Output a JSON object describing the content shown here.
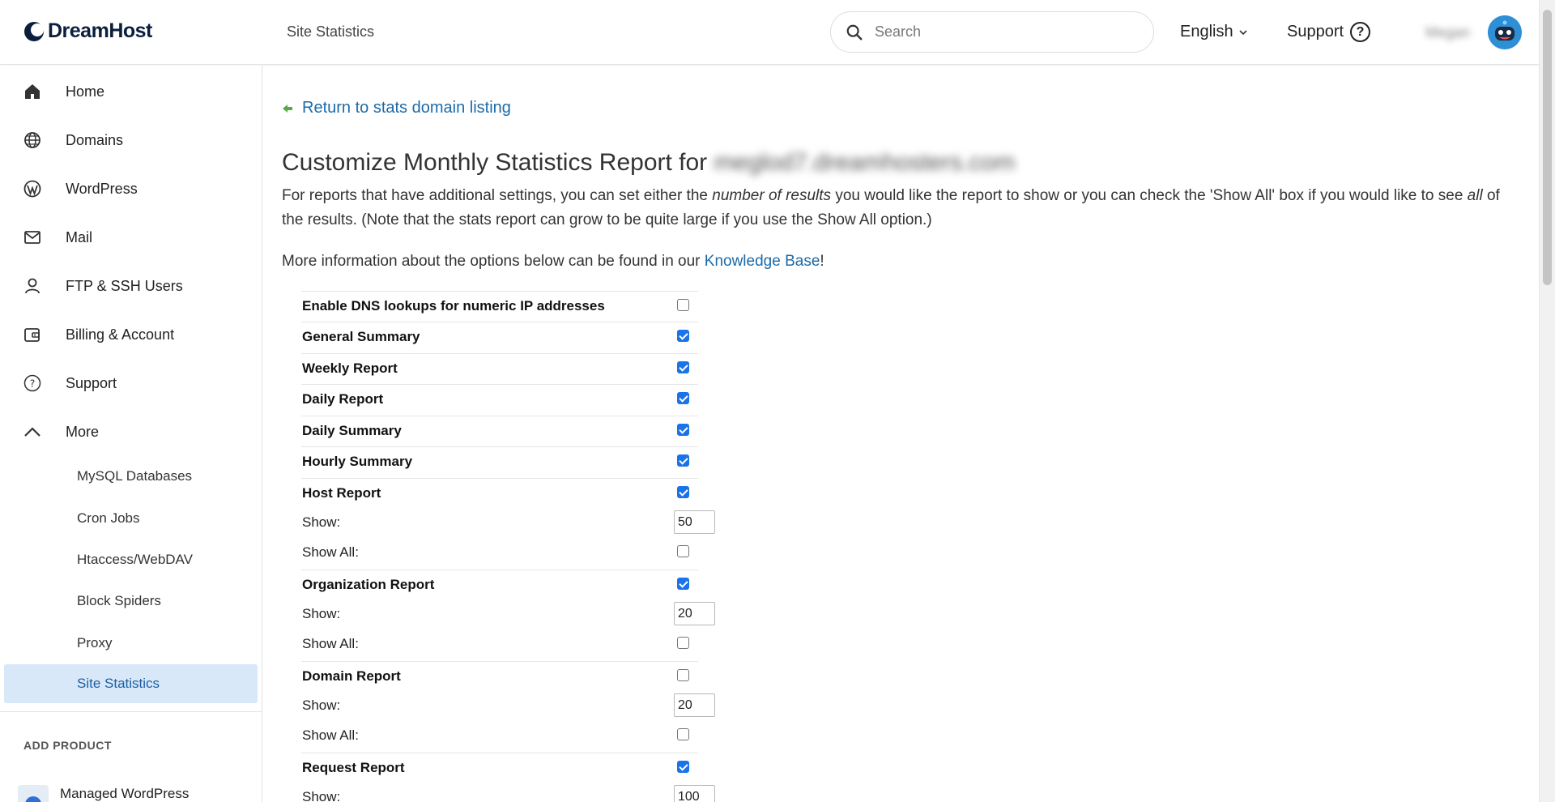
{
  "header": {
    "logo_text": "DreamHost",
    "page_crumb": "Site Statistics",
    "search_placeholder": "Search",
    "language": "English",
    "support_label": "Support",
    "username": "Megan"
  },
  "sidebar": {
    "items": [
      {
        "label": "Home",
        "icon": "home-icon"
      },
      {
        "label": "Domains",
        "icon": "globe-icon"
      },
      {
        "label": "WordPress",
        "icon": "wordpress-icon"
      },
      {
        "label": "Mail",
        "icon": "mail-icon"
      },
      {
        "label": "FTP & SSH Users",
        "icon": "user-icon"
      },
      {
        "label": "Billing & Account",
        "icon": "wallet-icon"
      },
      {
        "label": "Support",
        "icon": "help-icon"
      },
      {
        "label": "More",
        "icon": "chevron-up-icon"
      }
    ],
    "sub_items": [
      {
        "label": "MySQL Databases"
      },
      {
        "label": "Cron Jobs"
      },
      {
        "label": "Htaccess/WebDAV"
      },
      {
        "label": "Block Spiders"
      },
      {
        "label": "Proxy"
      },
      {
        "label": "Site Statistics",
        "active": true
      }
    ],
    "add_product_heading": "ADD PRODUCT",
    "managed_wordpress": "Managed WordPress"
  },
  "main": {
    "return_link": "Return to stats domain listing",
    "title_prefix": "Customize Monthly Statistics Report for ",
    "title_domain": "meglod7.dreamhosters.com",
    "intro_1": "For reports that have additional settings, you can set either the ",
    "intro_em1": "number of results",
    "intro_2": " you would like the report to show or you can check the 'Show All' box if you would like to see ",
    "intro_em2": "all",
    "intro_3": " of the results. (Note that the stats report can grow to be quite large if you use the Show All option.)",
    "more_info": "More information about the options below can be found in our ",
    "kb_link": "Knowledge Base",
    "kb_suffix": "!"
  },
  "settings": [
    {
      "type": "head",
      "label": "Enable DNS lookups for numeric IP addresses",
      "checked": false
    },
    {
      "type": "head",
      "label": "General Summary",
      "checked": true
    },
    {
      "type": "head",
      "label": "Weekly Report",
      "checked": true
    },
    {
      "type": "head",
      "label": "Daily Report",
      "checked": true
    },
    {
      "type": "head",
      "label": "Daily Summary",
      "checked": true
    },
    {
      "type": "head",
      "label": "Hourly Summary",
      "checked": true
    },
    {
      "type": "head",
      "label": "Host Report",
      "checked": true
    },
    {
      "type": "show",
      "label": "Show:",
      "value": "50"
    },
    {
      "type": "showall",
      "label": "Show All:",
      "checked": false
    },
    {
      "type": "head",
      "label": "Organization Report",
      "checked": true
    },
    {
      "type": "show",
      "label": "Show:",
      "value": "20"
    },
    {
      "type": "showall",
      "label": "Show All:",
      "checked": false
    },
    {
      "type": "head",
      "label": "Domain Report",
      "checked": false
    },
    {
      "type": "show",
      "label": "Show:",
      "value": "20"
    },
    {
      "type": "showall",
      "label": "Show All:",
      "checked": false
    },
    {
      "type": "head",
      "label": "Request Report",
      "checked": true
    },
    {
      "type": "show",
      "label": "Show:",
      "value": "100"
    }
  ]
}
